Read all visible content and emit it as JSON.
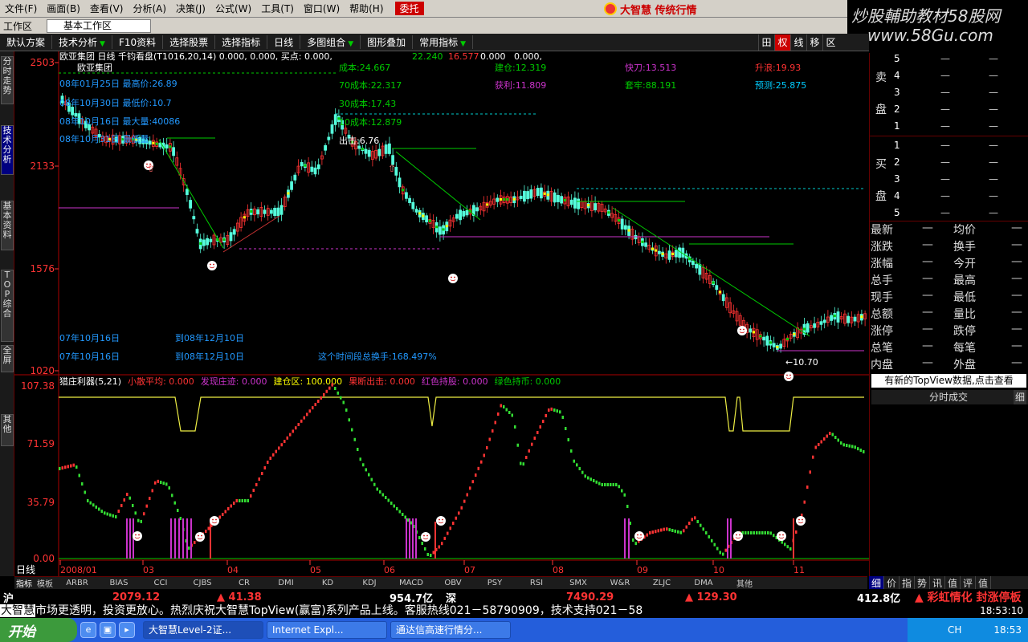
{
  "menubar": {
    "items": [
      "文件(F)",
      "画面(B)",
      "查看(V)",
      "分析(A)",
      "决策(J)",
      "公式(W)",
      "工具(T)",
      "窗口(W)",
      "帮助(H)"
    ],
    "highlight": "委托",
    "brand": "大智慧 传统行情"
  },
  "watermark": {
    "line1": "炒股輔助教材58股网",
    "line2": "www.58Gu.com"
  },
  "workbar": {
    "label": "工作区",
    "tab": "基本工作区"
  },
  "toolbar": {
    "items": [
      "默认方案",
      "技术分析",
      "F10资料",
      "选择股票",
      "选择指标",
      "日线",
      "多图组合",
      "图形叠加",
      "常用指标"
    ],
    "right": [
      "田",
      "权",
      "线",
      "移",
      "区"
    ]
  },
  "lefttabs": [
    "分时走势",
    "技术分析",
    "基本资料",
    "TOP综合",
    "全屏",
    "其他"
  ],
  "main_chart": {
    "header": "欧亚集团 日线  千钧看盘(T1016,20,14)  0.000, 0.000, 买点: 0.000,",
    "header_vals": [
      "22.240",
      "16.577",
      "0.000",
      "0.000,"
    ],
    "stock": "欧亚集团",
    "y_ticks": [
      "2503",
      "2133",
      "1576",
      "1020"
    ],
    "info_left": [
      "08年01月25日 最高价:26.89",
      "08年10月30日 最低价:10.7",
      "08年10月16日 最大量:40086",
      "08年10月31日 最低量"
    ],
    "cost": [
      "成本:24.667",
      "70成本:22.317",
      "30成本:17.43",
      "10成本:12.879",
      "出击:6.76"
    ],
    "stats": [
      {
        "k": "建仓",
        "v": "12.319"
      },
      {
        "k": "获利",
        "v": "11.809"
      },
      {
        "k": "快刀",
        "v": "13.513"
      },
      {
        "k": "套牢",
        "v": "88.191"
      },
      {
        "k": "升浪",
        "v": "19.93"
      },
      {
        "k": "预测",
        "v": "25.875"
      }
    ],
    "range": [
      "07年10月16日",
      "到08年12月10日",
      "07年10月16日",
      "到08年12月10日"
    ],
    "turnover": "这个时间段总换手:168.497%",
    "low_mark": "10.70"
  },
  "indicator": {
    "header": "猎庄利器(5,21)",
    "items": [
      {
        "k": "小散平均",
        "v": "0.000"
      },
      {
        "k": "发现庄迹",
        "v": "0.000"
      },
      {
        "k": "建仓区",
        "v": "100.000"
      },
      {
        "k": "果断出击",
        "v": "0.000"
      },
      {
        "k": "红色持股",
        "v": "0.000"
      },
      {
        "k": "绿色持币",
        "v": "0.000"
      }
    ],
    "y_ticks": [
      "107.38",
      "71.59",
      "35.79",
      "0.00"
    ],
    "x_ticks": [
      "2008/01",
      "03",
      "04",
      "05",
      "06",
      "07",
      "08",
      "09",
      "10",
      "11"
    ],
    "period": "日线"
  },
  "orderbook": {
    "sell_label": [
      "卖",
      "盘"
    ],
    "buy_label": [
      "买",
      "盘"
    ],
    "sell_levels": [
      "5",
      "4",
      "3",
      "2",
      "1"
    ],
    "buy_levels": [
      "1",
      "2",
      "3",
      "4",
      "5"
    ],
    "dash": "—"
  },
  "quote": [
    [
      "最新",
      "均价"
    ],
    [
      "涨跌",
      "换手"
    ],
    [
      "涨幅",
      "今开"
    ],
    [
      "总手",
      "最高"
    ],
    [
      "现手",
      "最低"
    ],
    [
      "总额",
      "量比"
    ],
    [
      "涨停",
      "跌停"
    ],
    [
      "总笔",
      "每笔"
    ],
    [
      "内盘",
      "外盘"
    ]
  ],
  "topview": "有新的TopView数据,点击查看",
  "fenshi": "分时成交",
  "fenshi_right": "细",
  "ind_tabs": [
    "指标",
    "模板",
    "ARBR",
    "BIAS",
    "CCI",
    "CJBS",
    "CR",
    "DMI",
    "KD",
    "KDJ",
    "MACD",
    "OBV",
    "PSY",
    "RSI",
    "SMX",
    "W&R",
    "ZLJC",
    "DMA",
    "其他"
  ],
  "r_tabs": [
    "细",
    "价",
    "指",
    "势",
    "讯",
    "值",
    "评",
    "值"
  ],
  "index_bar": {
    "market": "沪",
    "sh": "2079.12",
    "sh_chg": "▲ 41.38",
    "amt": "954.7亿",
    "sz_label": "深",
    "sz": "7490.29",
    "sz_chg": "▲ 129.30",
    "amt2": "412.8亿",
    "notice": "彩虹情化 封涨停板"
  },
  "ticker": {
    "hl": "大智慧",
    "text": "市场更透明，投资更放心。热烈庆祝大智慧TopView(赢富)系列产品上线。客服热线021－58790909，技术支持021－58"
  },
  "taskbar": {
    "start": "开始",
    "tasks": [
      "大智慧Level-2证...",
      "Internet Expl...",
      "通达信高速行情分..."
    ],
    "lang": "CH",
    "time": "18:53"
  },
  "tray_time": "18:53:10"
}
